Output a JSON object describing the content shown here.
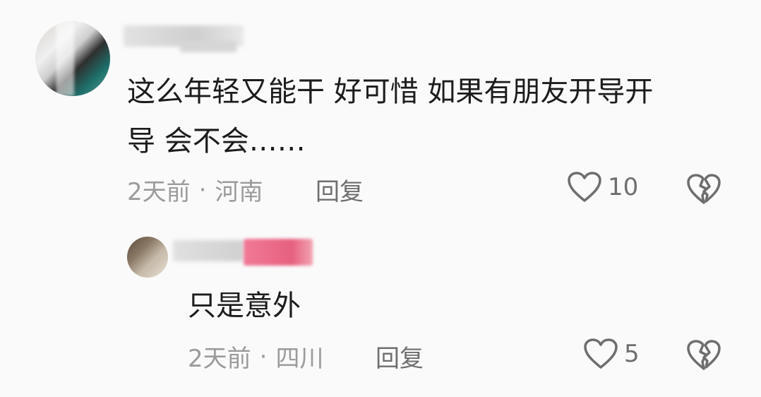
{
  "comments": [
    {
      "text_line1": "这么年轻又能干 好可惜 如果有朋友开导开",
      "text_line2": "导 会不会……",
      "time": "2天前",
      "separator": "·",
      "location": "河南",
      "reply_label": "回复",
      "likes": "10",
      "avatar_icon": "user-avatar",
      "like_icon": "heart-icon",
      "dislike_icon": "broken-heart-icon"
    }
  ],
  "replies": [
    {
      "text": "只是意外",
      "time": "2天前",
      "separator": "·",
      "location": "四川",
      "reply_label": "回复",
      "likes": "5",
      "avatar_icon": "user-avatar",
      "like_icon": "heart-icon",
      "dislike_icon": "broken-heart-icon"
    }
  ],
  "colors": {
    "text": "#1c1c1c",
    "meta": "#9b9b9b",
    "icon": "#6e6e6e",
    "background": "#fafafa"
  }
}
